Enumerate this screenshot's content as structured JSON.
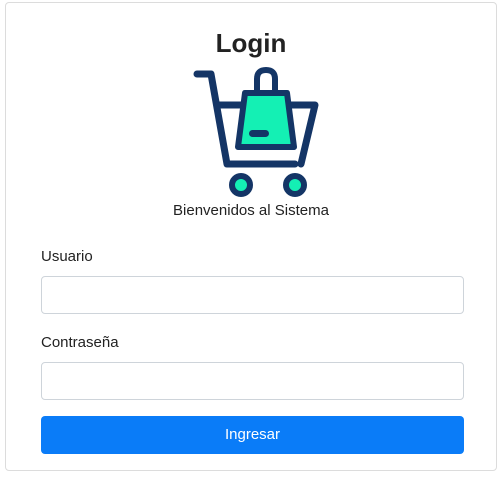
{
  "login": {
    "title": "Login",
    "welcome": "Bienvenidos al Sistema",
    "logo_icon": "shopping-cart-with-bag-icon",
    "username_label": "Usuario",
    "username_value": "",
    "password_label": "Contraseña",
    "password_value": "",
    "submit_label": "Ingresar"
  },
  "colors": {
    "primary_button": "#0a7cf8",
    "cart_outline": "#143566",
    "bag_fill": "#14f0b4",
    "card_border": "#dcdcdc",
    "input_border": "#ced4da"
  }
}
